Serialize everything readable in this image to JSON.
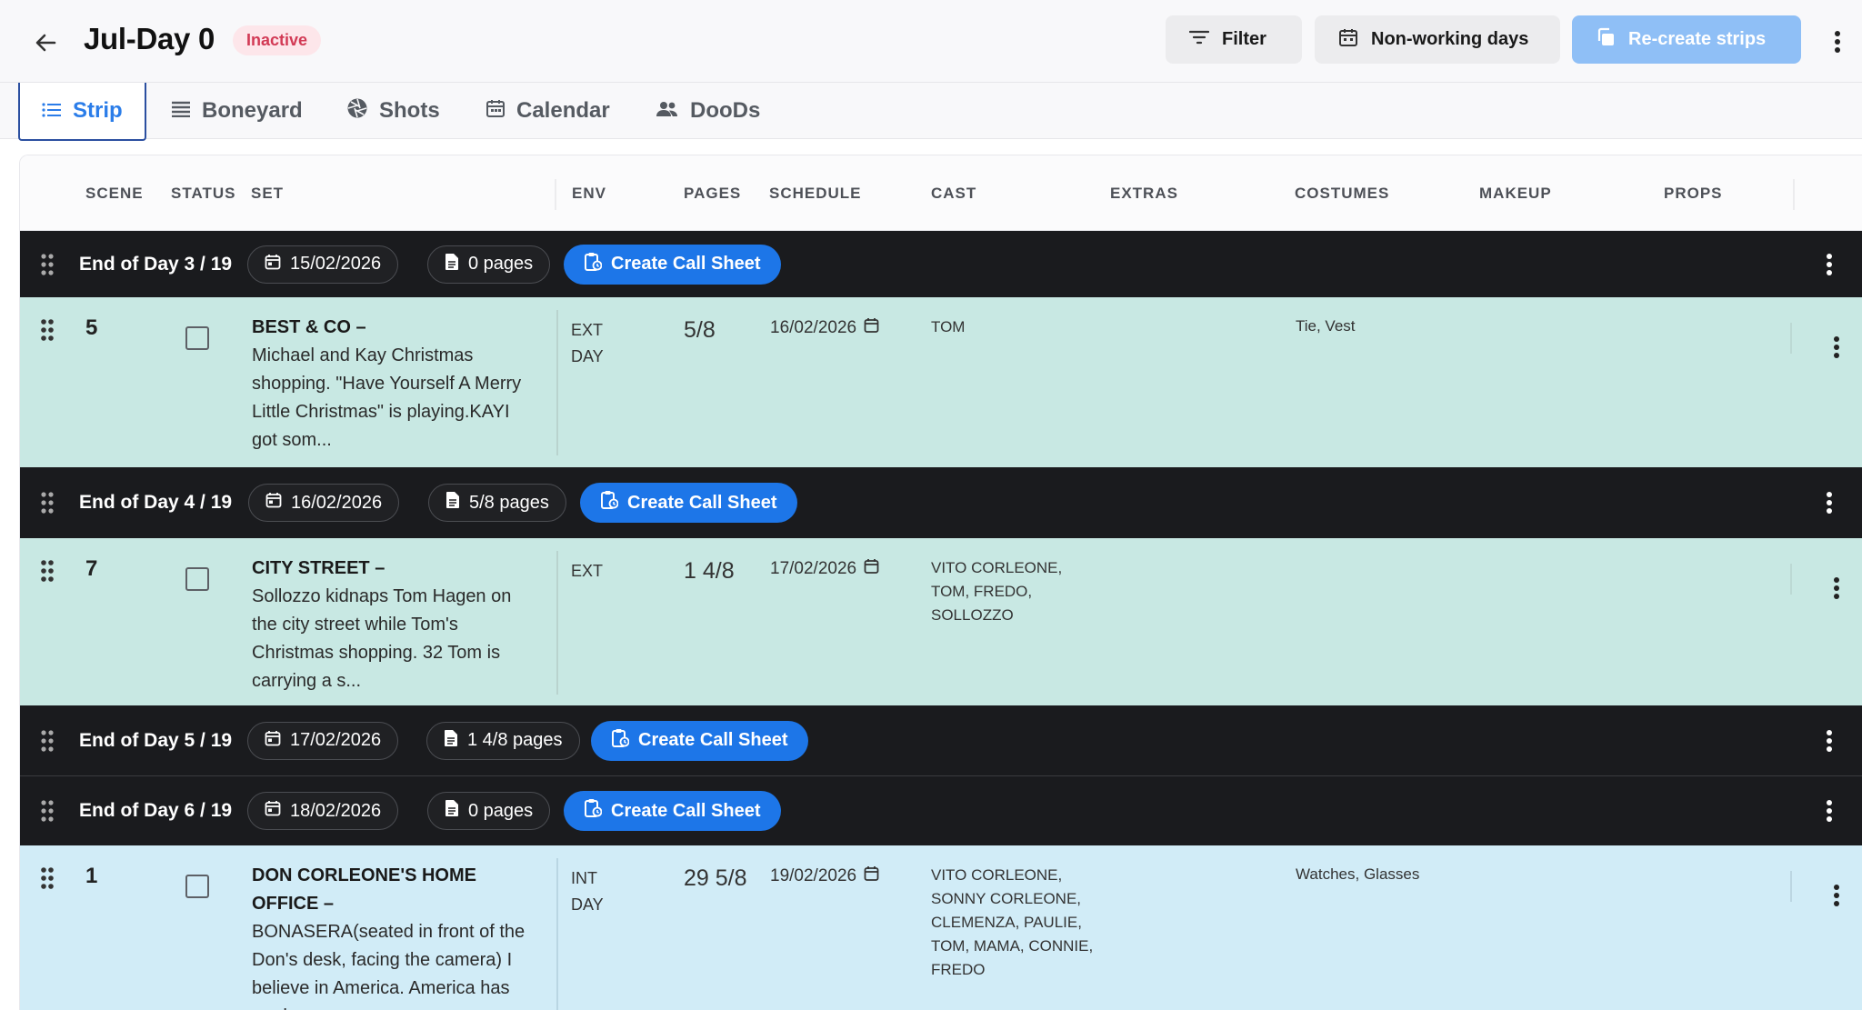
{
  "header": {
    "title": "Jul-Day 0",
    "status": "Inactive",
    "filter_label": "Filter",
    "nonworking_label": "Non-working days",
    "recreate_label": "Re-create strips"
  },
  "tabs": [
    {
      "label": "Strip",
      "icon": "list-icon",
      "active": true
    },
    {
      "label": "Boneyard",
      "icon": "boneyard-icon"
    },
    {
      "label": "Shots",
      "icon": "aperture-icon"
    },
    {
      "label": "Calendar",
      "icon": "calendar-icon"
    },
    {
      "label": "DooDs",
      "icon": "people-icon"
    }
  ],
  "columns": {
    "scene": "SCENE",
    "status": "STATUS",
    "set": "SET",
    "env": "ENV",
    "pages": "PAGES",
    "schedule": "SCHEDULE",
    "cast": "CAST",
    "extras": "EXTRAS",
    "costumes": "COSTUMES",
    "makeup": "MAKEUP",
    "props": "PROPS"
  },
  "call_sheet_label": "Create Call Sheet",
  "days": [
    {
      "label": "End of Day 3 / 19",
      "date": "15/02/2026",
      "pages": "0 pages"
    },
    {
      "label": "End of Day 4 / 19",
      "date": "16/02/2026",
      "pages": "5/8 pages"
    },
    {
      "label": "End of Day 5 / 19",
      "date": "17/02/2026",
      "pages": "1 4/8 pages"
    },
    {
      "label": "End of Day 6 / 19",
      "date": "18/02/2026",
      "pages": "0 pages"
    }
  ],
  "scenes": [
    {
      "number": "5",
      "set_title": "BEST & CO –",
      "set_lines": [
        "Michael and Kay Christmas",
        "shopping. \"Have Yourself A Merry",
        "Little Christmas\" is playing.KAYI",
        "got som..."
      ],
      "env_lines": [
        "EXT",
        "DAY"
      ],
      "pages": "5/8",
      "schedule": "16/02/2026",
      "cast_lines": [
        "TOM"
      ],
      "costumes": "Tie, Vest",
      "color": "#c8e8e3"
    },
    {
      "number": "7",
      "set_title": "CITY STREET –",
      "set_lines": [
        "Sollozzo kidnaps Tom Hagen on",
        "the city street while Tom's",
        "Christmas shopping. 32 Tom is",
        "carrying a s..."
      ],
      "env_lines": [
        "EXT"
      ],
      "pages": "1 4/8",
      "schedule": "17/02/2026",
      "cast_lines": [
        "VITO CORLEONE,",
        "TOM, FREDO,",
        "SOLLOZZO"
      ],
      "costumes": "",
      "color": "#c8e8e3"
    },
    {
      "number": "1",
      "set_title_lines": [
        "DON CORLEONE'S HOME",
        "OFFICE –"
      ],
      "set_lines": [
        "BONASERA(seated in front of the",
        "Don's desk, facing the camera) I",
        "believe in America. America has",
        "mad..."
      ],
      "env_lines": [
        "INT",
        "DAY"
      ],
      "pages": "29 5/8",
      "schedule": "19/02/2026",
      "cast_lines": [
        "VITO CORLEONE,",
        "SONNY CORLEONE,",
        "CLEMENZA, PAULIE,",
        "TOM, MAMA, CONNIE,",
        "FREDO"
      ],
      "costumes": "Watches, Glasses",
      "color": "#d1ecf7"
    }
  ]
}
